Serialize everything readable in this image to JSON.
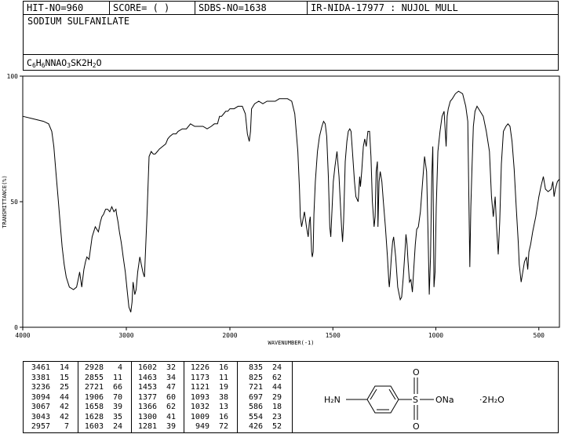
{
  "header": {
    "hit_no": "HIT-NO=960",
    "score": "SCORE=  (   )",
    "sdbs_no": "SDBS-NO=1638",
    "ir_info": "IR-NIDA-17977 : NUJOL MULL",
    "compound_name": "SODIUM SULFANILATE",
    "formula_parts": [
      "C",
      "6",
      "H",
      "6",
      "NNAO",
      "3",
      "SK2H",
      "2",
      "O"
    ]
  },
  "chart_data": {
    "type": "line",
    "title": "",
    "xlabel": "WAVENUMBER(-1)",
    "ylabel": "TRANSMITTANCE(%)",
    "xlim": [
      4000,
      400
    ],
    "ylim": [
      0,
      100
    ],
    "x_ticks": [
      "4000",
      "3000",
      "2000",
      "1500",
      "1000",
      "500"
    ],
    "y_ticks": [
      "0",
      "50",
      "100"
    ],
    "series": [
      {
        "points": [
          [
            4000,
            84
          ],
          [
            3900,
            83
          ],
          [
            3800,
            82
          ],
          [
            3750,
            81
          ],
          [
            3720,
            78
          ],
          [
            3700,
            72
          ],
          [
            3680,
            62
          ],
          [
            3660,
            52
          ],
          [
            3640,
            42
          ],
          [
            3620,
            32
          ],
          [
            3600,
            25
          ],
          [
            3580,
            20
          ],
          [
            3550,
            16
          ],
          [
            3510,
            15
          ],
          [
            3480,
            16
          ],
          [
            3460,
            20
          ],
          [
            3451,
            22
          ],
          [
            3430,
            16
          ],
          [
            3410,
            23
          ],
          [
            3395,
            26
          ],
          [
            3381,
            28
          ],
          [
            3360,
            27
          ],
          [
            3330,
            36
          ],
          [
            3300,
            40
          ],
          [
            3270,
            38
          ],
          [
            3250,
            42
          ],
          [
            3236,
            44
          ],
          [
            3220,
            45
          ],
          [
            3200,
            47
          ],
          [
            3180,
            47
          ],
          [
            3160,
            46
          ],
          [
            3140,
            48
          ],
          [
            3120,
            46
          ],
          [
            3100,
            47
          ],
          [
            3094,
            45
          ],
          [
            3080,
            42
          ],
          [
            3067,
            38
          ],
          [
            3050,
            34
          ],
          [
            3043,
            32
          ],
          [
            3030,
            28
          ],
          [
            3010,
            22
          ],
          [
            2990,
            14
          ],
          [
            2975,
            8
          ],
          [
            2965,
            7
          ],
          [
            2957,
            6
          ],
          [
            2945,
            10
          ],
          [
            2935,
            18
          ],
          [
            2928,
            16
          ],
          [
            2918,
            13
          ],
          [
            2905,
            15
          ],
          [
            2890,
            22
          ],
          [
            2870,
            28
          ],
          [
            2855,
            25
          ],
          [
            2840,
            22
          ],
          [
            2825,
            20
          ],
          [
            2800,
            45
          ],
          [
            2780,
            68
          ],
          [
            2760,
            70
          ],
          [
            2740,
            69
          ],
          [
            2721,
            69
          ],
          [
            2700,
            70
          ],
          [
            2680,
            71
          ],
          [
            2650,
            72
          ],
          [
            2620,
            73
          ],
          [
            2600,
            75
          ],
          [
            2580,
            76
          ],
          [
            2550,
            77
          ],
          [
            2520,
            77
          ],
          [
            2500,
            78
          ],
          [
            2460,
            79
          ],
          [
            2420,
            79
          ],
          [
            2380,
            81
          ],
          [
            2340,
            80
          ],
          [
            2300,
            80
          ],
          [
            2260,
            80
          ],
          [
            2220,
            79
          ],
          [
            2180,
            80
          ],
          [
            2150,
            81
          ],
          [
            2120,
            81
          ],
          [
            2100,
            84
          ],
          [
            2080,
            84
          ],
          [
            2060,
            85
          ],
          [
            2040,
            86
          ],
          [
            2020,
            86
          ],
          [
            2000,
            87
          ],
          [
            1980,
            87
          ],
          [
            1960,
            88
          ],
          [
            1940,
            88
          ],
          [
            1925,
            85
          ],
          [
            1915,
            77
          ],
          [
            1906,
            74
          ],
          [
            1900,
            78
          ],
          [
            1895,
            87
          ],
          [
            1880,
            89
          ],
          [
            1860,
            90
          ],
          [
            1840,
            89
          ],
          [
            1820,
            90
          ],
          [
            1800,
            90
          ],
          [
            1780,
            90
          ],
          [
            1760,
            91
          ],
          [
            1740,
            91
          ],
          [
            1720,
            91
          ],
          [
            1700,
            90
          ],
          [
            1685,
            85
          ],
          [
            1670,
            70
          ],
          [
            1662,
            55
          ],
          [
            1658,
            44
          ],
          [
            1652,
            40
          ],
          [
            1645,
            43
          ],
          [
            1638,
            46
          ],
          [
            1628,
            40
          ],
          [
            1620,
            36
          ],
          [
            1614,
            42
          ],
          [
            1610,
            44
          ],
          [
            1603,
            30
          ],
          [
            1600,
            28
          ],
          [
            1596,
            30
          ],
          [
            1592,
            45
          ],
          [
            1585,
            58
          ],
          [
            1575,
            70
          ],
          [
            1565,
            76
          ],
          [
            1553,
            80
          ],
          [
            1545,
            82
          ],
          [
            1537,
            81
          ],
          [
            1530,
            76
          ],
          [
            1522,
            60
          ],
          [
            1515,
            40
          ],
          [
            1510,
            36
          ],
          [
            1505,
            45
          ],
          [
            1498,
            58
          ],
          [
            1490,
            64
          ],
          [
            1480,
            70
          ],
          [
            1470,
            60
          ],
          [
            1463,
            48
          ],
          [
            1458,
            40
          ],
          [
            1453,
            34
          ],
          [
            1448,
            42
          ],
          [
            1440,
            66
          ],
          [
            1432,
            74
          ],
          [
            1425,
            78
          ],
          [
            1418,
            79
          ],
          [
            1412,
            78
          ],
          [
            1405,
            70
          ],
          [
            1395,
            58
          ],
          [
            1388,
            52
          ],
          [
            1377,
            50
          ],
          [
            1370,
            60
          ],
          [
            1366,
            56
          ],
          [
            1360,
            62
          ],
          [
            1352,
            72
          ],
          [
            1345,
            75
          ],
          [
            1338,
            72
          ],
          [
            1330,
            78
          ],
          [
            1322,
            78
          ],
          [
            1315,
            68
          ],
          [
            1308,
            50
          ],
          [
            1300,
            40
          ],
          [
            1295,
            44
          ],
          [
            1290,
            62
          ],
          [
            1284,
            66
          ],
          [
            1281,
            40
          ],
          [
            1276,
            58
          ],
          [
            1270,
            62
          ],
          [
            1262,
            58
          ],
          [
            1255,
            50
          ],
          [
            1245,
            40
          ],
          [
            1235,
            28
          ],
          [
            1228,
            18
          ],
          [
            1226,
            16
          ],
          [
            1222,
            20
          ],
          [
            1216,
            28
          ],
          [
            1210,
            34
          ],
          [
            1205,
            36
          ],
          [
            1195,
            28
          ],
          [
            1185,
            16
          ],
          [
            1178,
            13
          ],
          [
            1173,
            11
          ],
          [
            1166,
            12
          ],
          [
            1158,
            20
          ],
          [
            1150,
            30
          ],
          [
            1145,
            37
          ],
          [
            1140,
            33
          ],
          [
            1135,
            26
          ],
          [
            1128,
            18
          ],
          [
            1121,
            19
          ],
          [
            1114,
            14
          ],
          [
            1108,
            22
          ],
          [
            1100,
            33
          ],
          [
            1093,
            39
          ],
          [
            1085,
            40
          ],
          [
            1075,
            46
          ],
          [
            1065,
            57
          ],
          [
            1055,
            68
          ],
          [
            1045,
            62
          ],
          [
            1038,
            38
          ],
          [
            1032,
            13
          ],
          [
            1026,
            28
          ],
          [
            1020,
            60
          ],
          [
            1015,
            72
          ],
          [
            1009,
            16
          ],
          [
            1004,
            22
          ],
          [
            998,
            48
          ],
          [
            990,
            70
          ],
          [
            980,
            78
          ],
          [
            970,
            84
          ],
          [
            960,
            86
          ],
          [
            950,
            72
          ],
          [
            945,
            84
          ],
          [
            940,
            87
          ],
          [
            930,
            90
          ],
          [
            920,
            91
          ],
          [
            905,
            93
          ],
          [
            890,
            94
          ],
          [
            870,
            93
          ],
          [
            855,
            88
          ],
          [
            845,
            82
          ],
          [
            835,
            24
          ],
          [
            830,
            48
          ],
          [
            825,
            62
          ],
          [
            818,
            80
          ],
          [
            810,
            86
          ],
          [
            800,
            88
          ],
          [
            785,
            86
          ],
          [
            770,
            84
          ],
          [
            755,
            78
          ],
          [
            740,
            70
          ],
          [
            730,
            52
          ],
          [
            721,
            44
          ],
          [
            712,
            52
          ],
          [
            705,
            40
          ],
          [
            697,
            29
          ],
          [
            690,
            42
          ],
          [
            682,
            65
          ],
          [
            672,
            78
          ],
          [
            660,
            80
          ],
          [
            650,
            81
          ],
          [
            640,
            80
          ],
          [
            630,
            74
          ],
          [
            620,
            63
          ],
          [
            610,
            48
          ],
          [
            600,
            34
          ],
          [
            595,
            25
          ],
          [
            586,
            18
          ],
          [
            578,
            22
          ],
          [
            570,
            26
          ],
          [
            560,
            28
          ],
          [
            554,
            23
          ],
          [
            548,
            30
          ],
          [
            540,
            33
          ],
          [
            530,
            38
          ],
          [
            515,
            44
          ],
          [
            500,
            52
          ],
          [
            490,
            56
          ],
          [
            478,
            60
          ],
          [
            468,
            55
          ],
          [
            455,
            54
          ],
          [
            440,
            55
          ],
          [
            432,
            58
          ],
          [
            426,
            52
          ],
          [
            420,
            55
          ],
          [
            410,
            58
          ],
          [
            400,
            59
          ]
        ]
      }
    ]
  },
  "peak_table": [
    {
      "wn": [
        "3461",
        "3381",
        "3236",
        "3094",
        "3067",
        "3043",
        "2957"
      ],
      "t": [
        "14",
        "15",
        "25",
        "44",
        "42",
        "42",
        "7"
      ]
    },
    {
      "wn": [
        "2928",
        "2855",
        "2721",
        "1906",
        "1658",
        "1628",
        "1603"
      ],
      "t": [
        "4",
        "11",
        "66",
        "70",
        "39",
        "35",
        "24"
      ]
    },
    {
      "wn": [
        "1602",
        "1463",
        "1453",
        "1377",
        "1366",
        "1300",
        "1281"
      ],
      "t": [
        "32",
        "34",
        "47",
        "60",
        "62",
        "41",
        "39"
      ]
    },
    {
      "wn": [
        "1226",
        "1173",
        "1121",
        "1093",
        "1032",
        "1009",
        "949"
      ],
      "t": [
        "16",
        "11",
        "19",
        "38",
        "13",
        "16",
        "72"
      ]
    },
    {
      "wn": [
        "835",
        "825",
        "721",
        "697",
        "586",
        "554",
        "426"
      ],
      "t": [
        "24",
        "62",
        "44",
        "29",
        "18",
        "23",
        "52"
      ]
    }
  ],
  "structure": {
    "amine": "H₂N",
    "sulfur": "S",
    "oxygen_top": "O",
    "oxygen_bottom": "O",
    "ona": "ONa",
    "hydrate": "·2H₂O"
  }
}
